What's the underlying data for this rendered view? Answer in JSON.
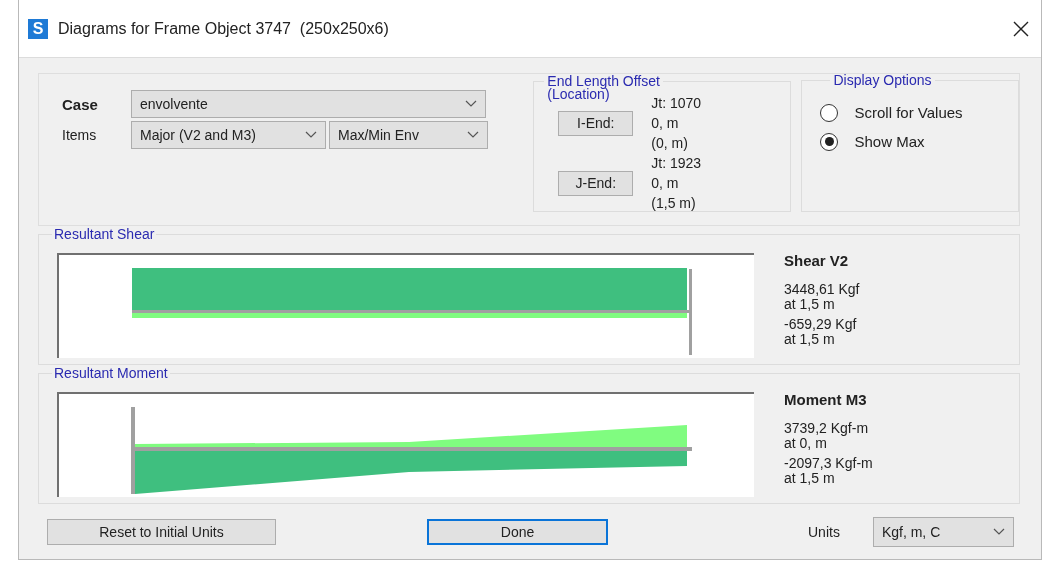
{
  "window": {
    "icon_letter": "S",
    "title": "Diagrams for Frame Object 3747  (250x250x6)"
  },
  "case": {
    "label": "Case",
    "value": "envolvente"
  },
  "items": {
    "label": "Items",
    "value": "Major (V2 and M3)",
    "mode": "Max/Min Env"
  },
  "end_length_offset": {
    "title": "End Length Offset",
    "subtitle": "(Location)",
    "ends": [
      {
        "button": "I-End:",
        "joint": "Jt:  1070",
        "offset": "0, m",
        "location": "(0, m)"
      },
      {
        "button": "J-End:",
        "joint": "Jt:  1923",
        "offset": "0, m",
        "location": "(1,5 m)"
      }
    ]
  },
  "display_options": {
    "title": "Display Options",
    "options": [
      {
        "label": "Scroll for Values",
        "selected": false
      },
      {
        "label": "Show Max",
        "selected": true
      }
    ]
  },
  "diagrams": [
    {
      "kind": "shear",
      "title": "Resultant Shear",
      "heading": "Shear V2",
      "readings": [
        {
          "value": "3448,61 Kgf",
          "at": "at 1,5 m"
        },
        {
          "value": "-659,29 Kgf",
          "at": "at 1,5 m"
        }
      ]
    },
    {
      "kind": "moment",
      "title": "Resultant Moment",
      "heading": "Moment M3",
      "readings": [
        {
          "value": "3739,2 Kgf-m",
          "at": "at 0, m"
        },
        {
          "value": "-2097,3 Kgf-m",
          "at": "at 1,5 m"
        }
      ]
    }
  ],
  "footer": {
    "reset_button": "Reset to Initial Units",
    "done_button": "Done",
    "units_label": "Units",
    "units_value": "Kgf, m, C"
  }
}
